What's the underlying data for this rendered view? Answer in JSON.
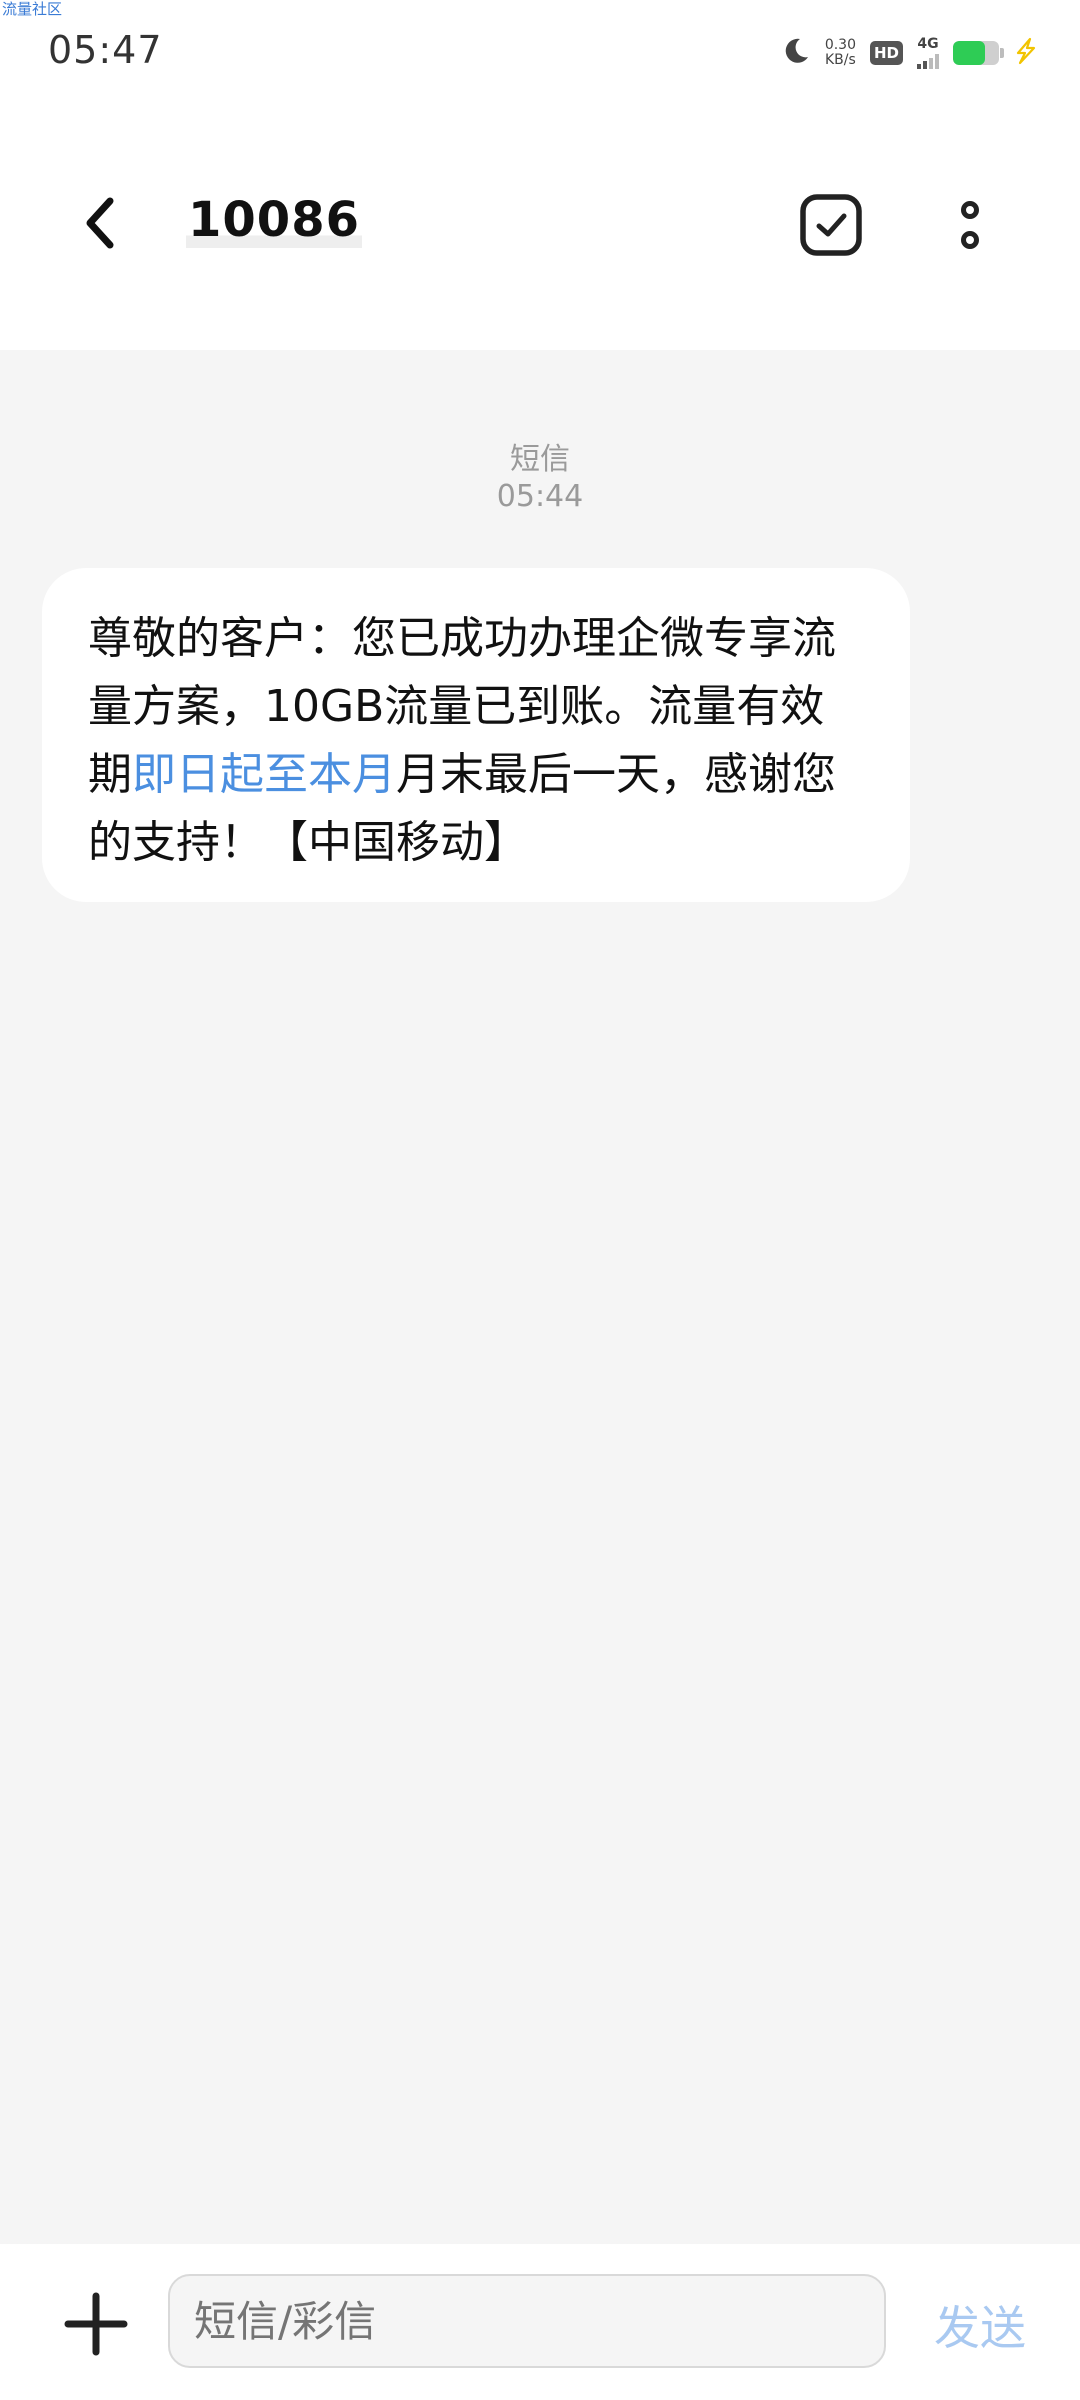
{
  "watermark": "流量社区",
  "status_bar": {
    "time": "05:47",
    "speed_value": "0.30",
    "speed_unit": "KB/s",
    "hd_badge": "HD",
    "network": "4G",
    "icons": [
      "moon-icon",
      "signal-icon",
      "battery-icon",
      "charging-icon"
    ]
  },
  "header": {
    "title": "10086",
    "icons": [
      "back-arrow-icon",
      "checkbox-select-icon",
      "more-vertical-icon"
    ]
  },
  "conversation": {
    "message_type": "短信",
    "timestamp": "05:44",
    "message": {
      "text_before": "尊敬的客户：您已成功办理企微专享流量方案，10GB流量已到账。流量有效期",
      "link_text": "即日起至本月",
      "text_after": "月末最后一天，感谢您的支持！【中国移动】"
    }
  },
  "composer": {
    "placeholder": "短信/彩信",
    "send_label": "发送",
    "icons": [
      "plus-icon"
    ]
  },
  "colors": {
    "link": "#4b8fe0",
    "send_disabled": "#a9c9f1",
    "battery_fill": "#2ecc55",
    "charging": "#f2c400"
  },
  "battery_level": 0.7
}
